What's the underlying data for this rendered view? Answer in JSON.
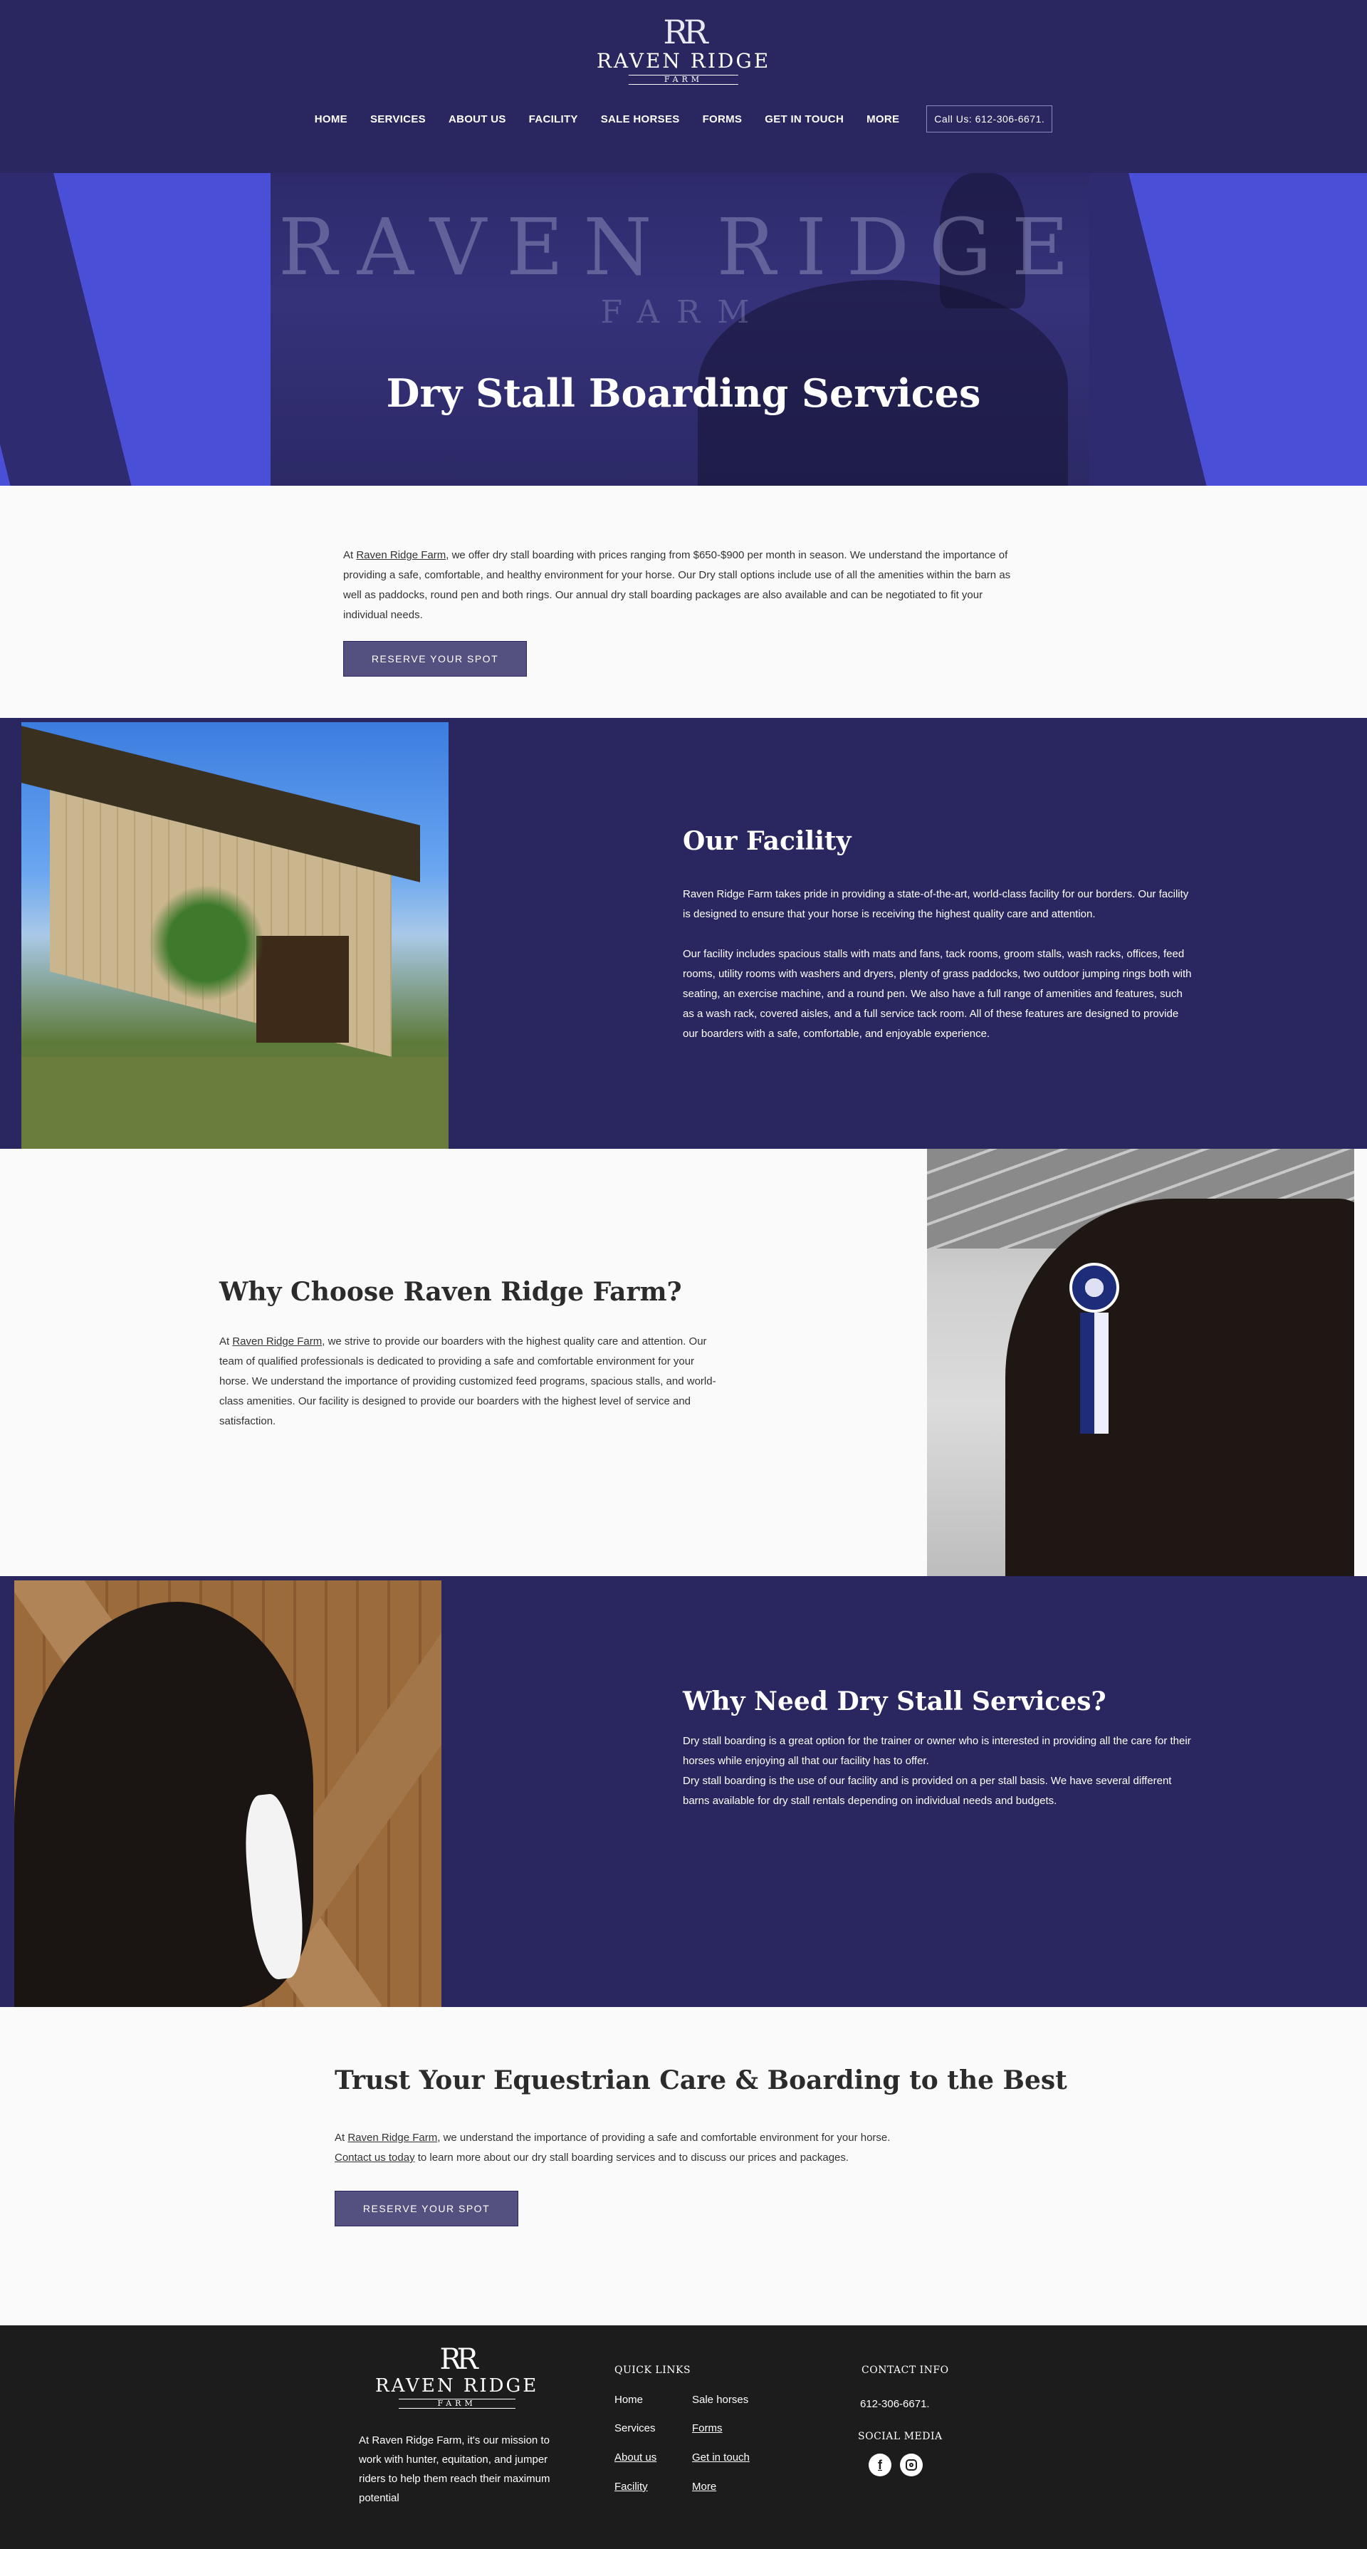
{
  "header": {
    "logo_mark": "RR",
    "logo_name": "RAVEN RIDGE",
    "logo_sub": "FARM",
    "nav": [
      "HOME",
      "SERVICES",
      "ABOUT US",
      "FACILITY",
      "SALE HORSES",
      "FORMS",
      "GET IN TOUCH",
      "MORE"
    ],
    "call": "Call Us: 612-306-6671."
  },
  "hero": {
    "bg_mark": "RAVEN RIDGE",
    "bg_sub": "FARM",
    "title": "Dry Stall Boarding Services"
  },
  "intro": {
    "pre": "At ",
    "link": "Raven Ridge Farm",
    "text": ", we offer dry stall boarding with prices ranging from $650-$900 per month in season. We understand the importance of providing a safe, comfortable, and healthy environment for your horse. Our Dry stall options include use of all the amenities within the barn as well as paddocks, round pen and both rings. Our annual dry stall boarding packages are also available and can be negotiated to fit your individual needs.",
    "button": "RESERVE YOUR SPOT"
  },
  "facility": {
    "title": "Our Facility",
    "p1": "Raven Ridge Farm takes pride in providing a state-of-the-art, world-class facility for our borders. Our facility is designed to ensure that your horse is receiving the highest quality care and attention.",
    "p2": "Our facility includes spacious stalls with mats and fans, tack rooms, groom stalls, wash racks, offices, feed rooms, utility rooms with washers and dryers, plenty of grass paddocks, two outdoor jumping rings both with seating, an exercise machine, and a round pen. We also have a full range of amenities and features, such as a wash rack, covered aisles, and a full service tack room. All of these features are designed to provide our boarders with a safe, comfortable, and enjoyable experience."
  },
  "choose": {
    "title": "Why Choose Raven Ridge Farm?",
    "pre": "At ",
    "link": "Raven Ridge Farm",
    "text": ", we strive to provide our boarders with the highest quality care and attention. Our team of qualified professionals is dedicated to providing a safe and comfortable environment for your horse. We understand the importance of providing customized feed programs, spacious stalls, and world-class amenities. Our facility is designed to provide our boarders with the highest level of service and satisfaction."
  },
  "need": {
    "title": "Why Need Dry Stall Services?",
    "p1": "Dry stall boarding is a great option for the trainer or owner who is interested in providing all the care for their horses while enjoying all that our facility has to offer.",
    "p2": "Dry stall boarding is the use of our facility and is provided on a per stall basis. We have several different barns available for dry stall rentals depending on individual needs and budgets."
  },
  "trust": {
    "title": "Trust Your Equestrian Care & Boarding to the Best",
    "pre": "At ",
    "link": "Raven Ridge Farm",
    "text": ", we understand the importance of providing a safe and comfortable environment for your horse.",
    "contact_link": "Contact us today",
    "contact_text": " to learn more about our dry stall boarding services and to discuss our prices and packages.",
    "button": "RESERVE YOUR SPOT"
  },
  "footer": {
    "logo_mark": "RR",
    "logo_name": "RAVEN RIDGE",
    "logo_sub": "FARM",
    "mission": "At Raven Ridge Farm, it's our mission to work with hunter, equitation, and jumper riders to help them reach their maximum potential",
    "quick_links_title": "QUICK LINKS",
    "links_col1": [
      "Home",
      "Services",
      "About us",
      "Facility"
    ],
    "links_col2": [
      "Sale horses",
      "Forms",
      "Get in touch",
      "More"
    ],
    "contact_title": "CONTACT  INFO",
    "phone": "612-306-6671.",
    "social_title": "SOCIAL MEDIA",
    "social_icons": [
      "facebook-icon",
      "instagram-icon"
    ]
  },
  "colors": {
    "primary": "#2a265f",
    "accent_blue": "#4a4fd8",
    "button": "#54507f",
    "footer": "#1c1c1c"
  }
}
